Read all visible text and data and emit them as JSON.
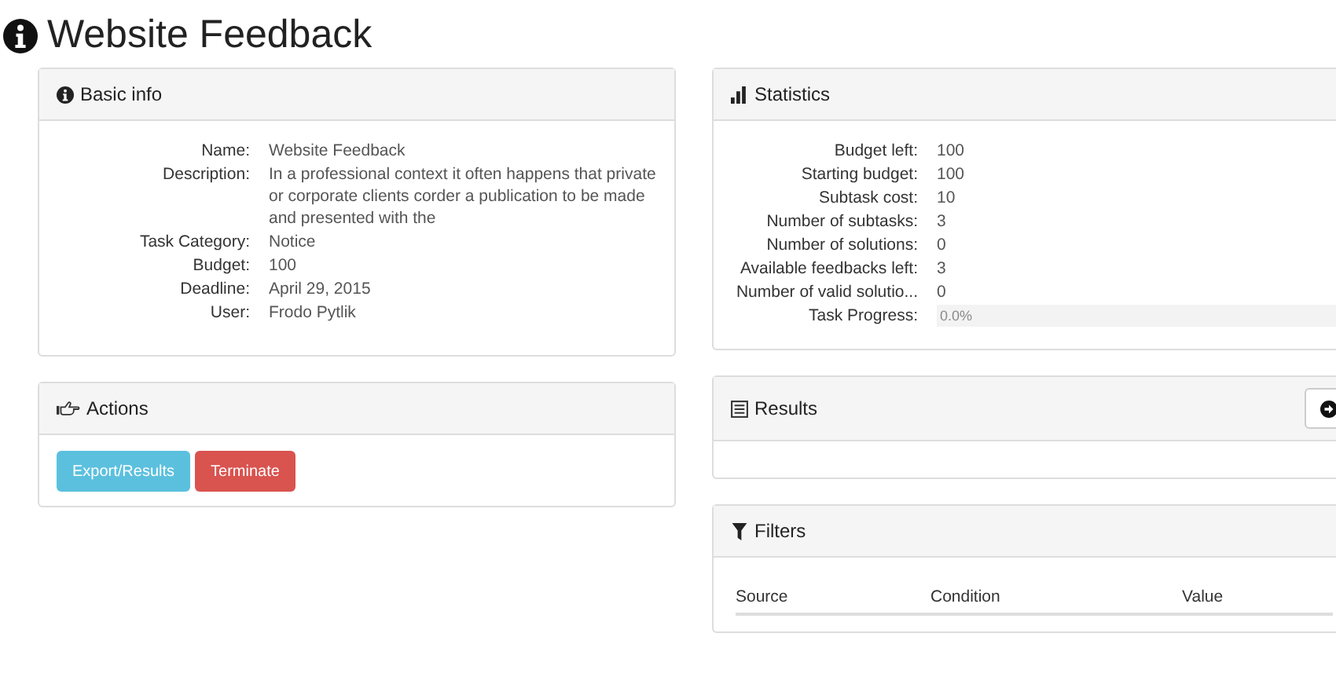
{
  "title": "Website Feedback",
  "basic_info": {
    "heading": "Basic info",
    "fields": [
      {
        "label": "Name:",
        "value": "Website Feedback"
      },
      {
        "label": "Description:",
        "value": "In a professional context it often happens that private or corporate clients corder a publication to be made and presented with the"
      },
      {
        "label": "Task Category:",
        "value": "Notice"
      },
      {
        "label": "Budget:",
        "value": "100"
      },
      {
        "label": "Deadline:",
        "value": "April 29, 2015"
      },
      {
        "label": "User:",
        "value": "Frodo Pytlik"
      }
    ]
  },
  "actions": {
    "heading": "Actions",
    "buttons": [
      {
        "label": "Export/Results",
        "kind": "info"
      },
      {
        "label": "Terminate",
        "kind": "danger"
      }
    ]
  },
  "statistics": {
    "heading": "Statistics",
    "fields": [
      {
        "label": "Budget left:",
        "value": "100"
      },
      {
        "label": "Starting budget:",
        "value": "100"
      },
      {
        "label": "Subtask cost:",
        "value": "10"
      },
      {
        "label": "Number of subtasks:",
        "value": "3"
      },
      {
        "label": "Number of solutions:",
        "value": "0"
      },
      {
        "label": "Available feedbacks left:",
        "value": "3"
      },
      {
        "label": "Number of valid solutio...",
        "value": "0"
      }
    ],
    "progress": {
      "label": "Task Progress:",
      "reading": "0.0%",
      "level": 0
    }
  },
  "results": {
    "heading": "Results"
  },
  "filters": {
    "heading": "Filters",
    "columns": [
      "Source",
      "Condition",
      "Value"
    ]
  }
}
